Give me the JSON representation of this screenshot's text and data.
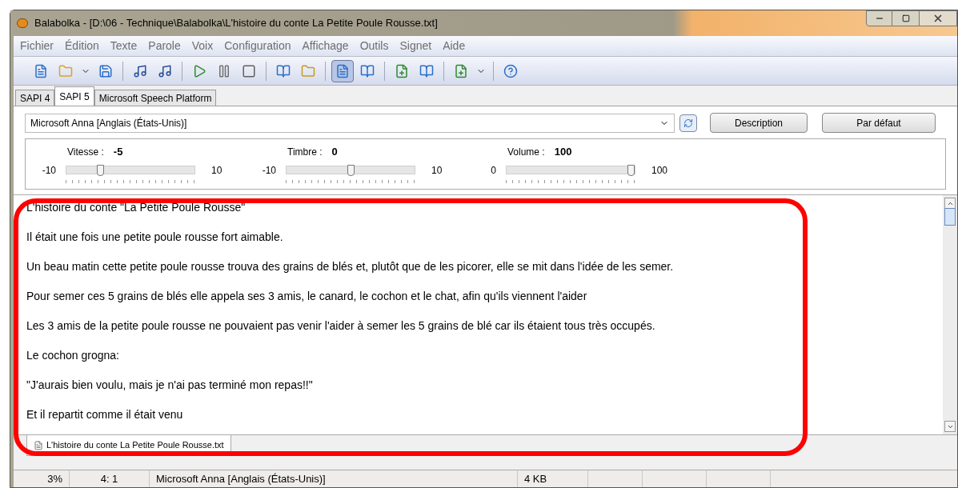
{
  "window": {
    "title": "Balabolka - [D:\\06 - Technique\\Balabolka\\L'histoire du conte La Petite Poule Rousse.txt]"
  },
  "menu": [
    "Fichier",
    "Édition",
    "Texte",
    "Parole",
    "Voix",
    "Configuration",
    "Affichage",
    "Outils",
    "Signet",
    "Aide"
  ],
  "toolbar": [
    [
      {
        "kind": "new",
        "selected": false
      },
      {
        "kind": "open",
        "selected": false
      },
      {
        "kind": "dropdown",
        "selected": false
      },
      {
        "kind": "save",
        "selected": false
      }
    ],
    [
      {
        "kind": "audio",
        "selected": false
      },
      {
        "kind": "audio",
        "selected": false
      }
    ],
    [
      {
        "kind": "play",
        "selected": false
      },
      {
        "kind": "pause",
        "selected": false
      },
      {
        "kind": "stop",
        "selected": false
      }
    ],
    [
      {
        "kind": "book",
        "selected": false
      },
      {
        "kind": "folder-play",
        "selected": false
      }
    ],
    [
      {
        "kind": "doc",
        "selected": true
      },
      {
        "kind": "book",
        "selected": false
      }
    ],
    [
      {
        "kind": "add",
        "selected": false
      },
      {
        "kind": "book",
        "selected": false
      }
    ],
    [
      {
        "kind": "add",
        "selected": false
      },
      {
        "kind": "dropdown",
        "selected": false
      }
    ],
    [
      {
        "kind": "help",
        "selected": false
      }
    ]
  ],
  "engine_tabs": [
    {
      "label": "SAPI 4",
      "selected": false
    },
    {
      "label": "SAPI 5",
      "selected": true
    },
    {
      "label": "Microsoft Speech Platform",
      "selected": false
    }
  ],
  "voice": {
    "value": "Microsoft Anna [Anglais (États-Unis)]",
    "description_button": "Description",
    "default_button": "Par défaut"
  },
  "sliders": [
    {
      "label": "Vitesse :",
      "reading": "-5",
      "min": "-10",
      "max": "10",
      "level": 0.25
    },
    {
      "label": "Timbre :",
      "reading": "0",
      "min": "-10",
      "max": "10",
      "level": 0.5
    },
    {
      "label": "Volume :",
      "reading": "100",
      "min": "0",
      "max": "100",
      "level": 1
    }
  ],
  "document": {
    "paragraphs": [
      "L'histoire du conte \"La Petite Poule Rousse\"",
      "Il était une fois une petite poule rousse fort aimable.",
      "Un beau matin cette petite poule rousse trouva des grains de blés et, plutôt que de les picorer, elle se mit dans l'idée de les semer.",
      "Pour semer ces 5 grains de blés elle appela ses 3 amis, le canard, le cochon et le chat, afin qu'ils viennent l'aider",
      "Les 3 amis de la petite poule rousse ne pouvaient pas venir l'aider à semer les 5 grains de blé car ils étaient tous très occupés.",
      "Le cochon grogna:",
      "\"J'aurais bien voulu, mais je n'ai pas terminé mon repas!!\"",
      "Et il repartit comme il était venu"
    ]
  },
  "document_tabs": [
    {
      "label": "L'histoire du conte La Petite Poule Rousse.txt",
      "selected": true
    }
  ],
  "status_bar": [
    "3%",
    "4:  1",
    "Microsoft Anna [Anglais (États-Unis)]",
    "4 KB"
  ]
}
